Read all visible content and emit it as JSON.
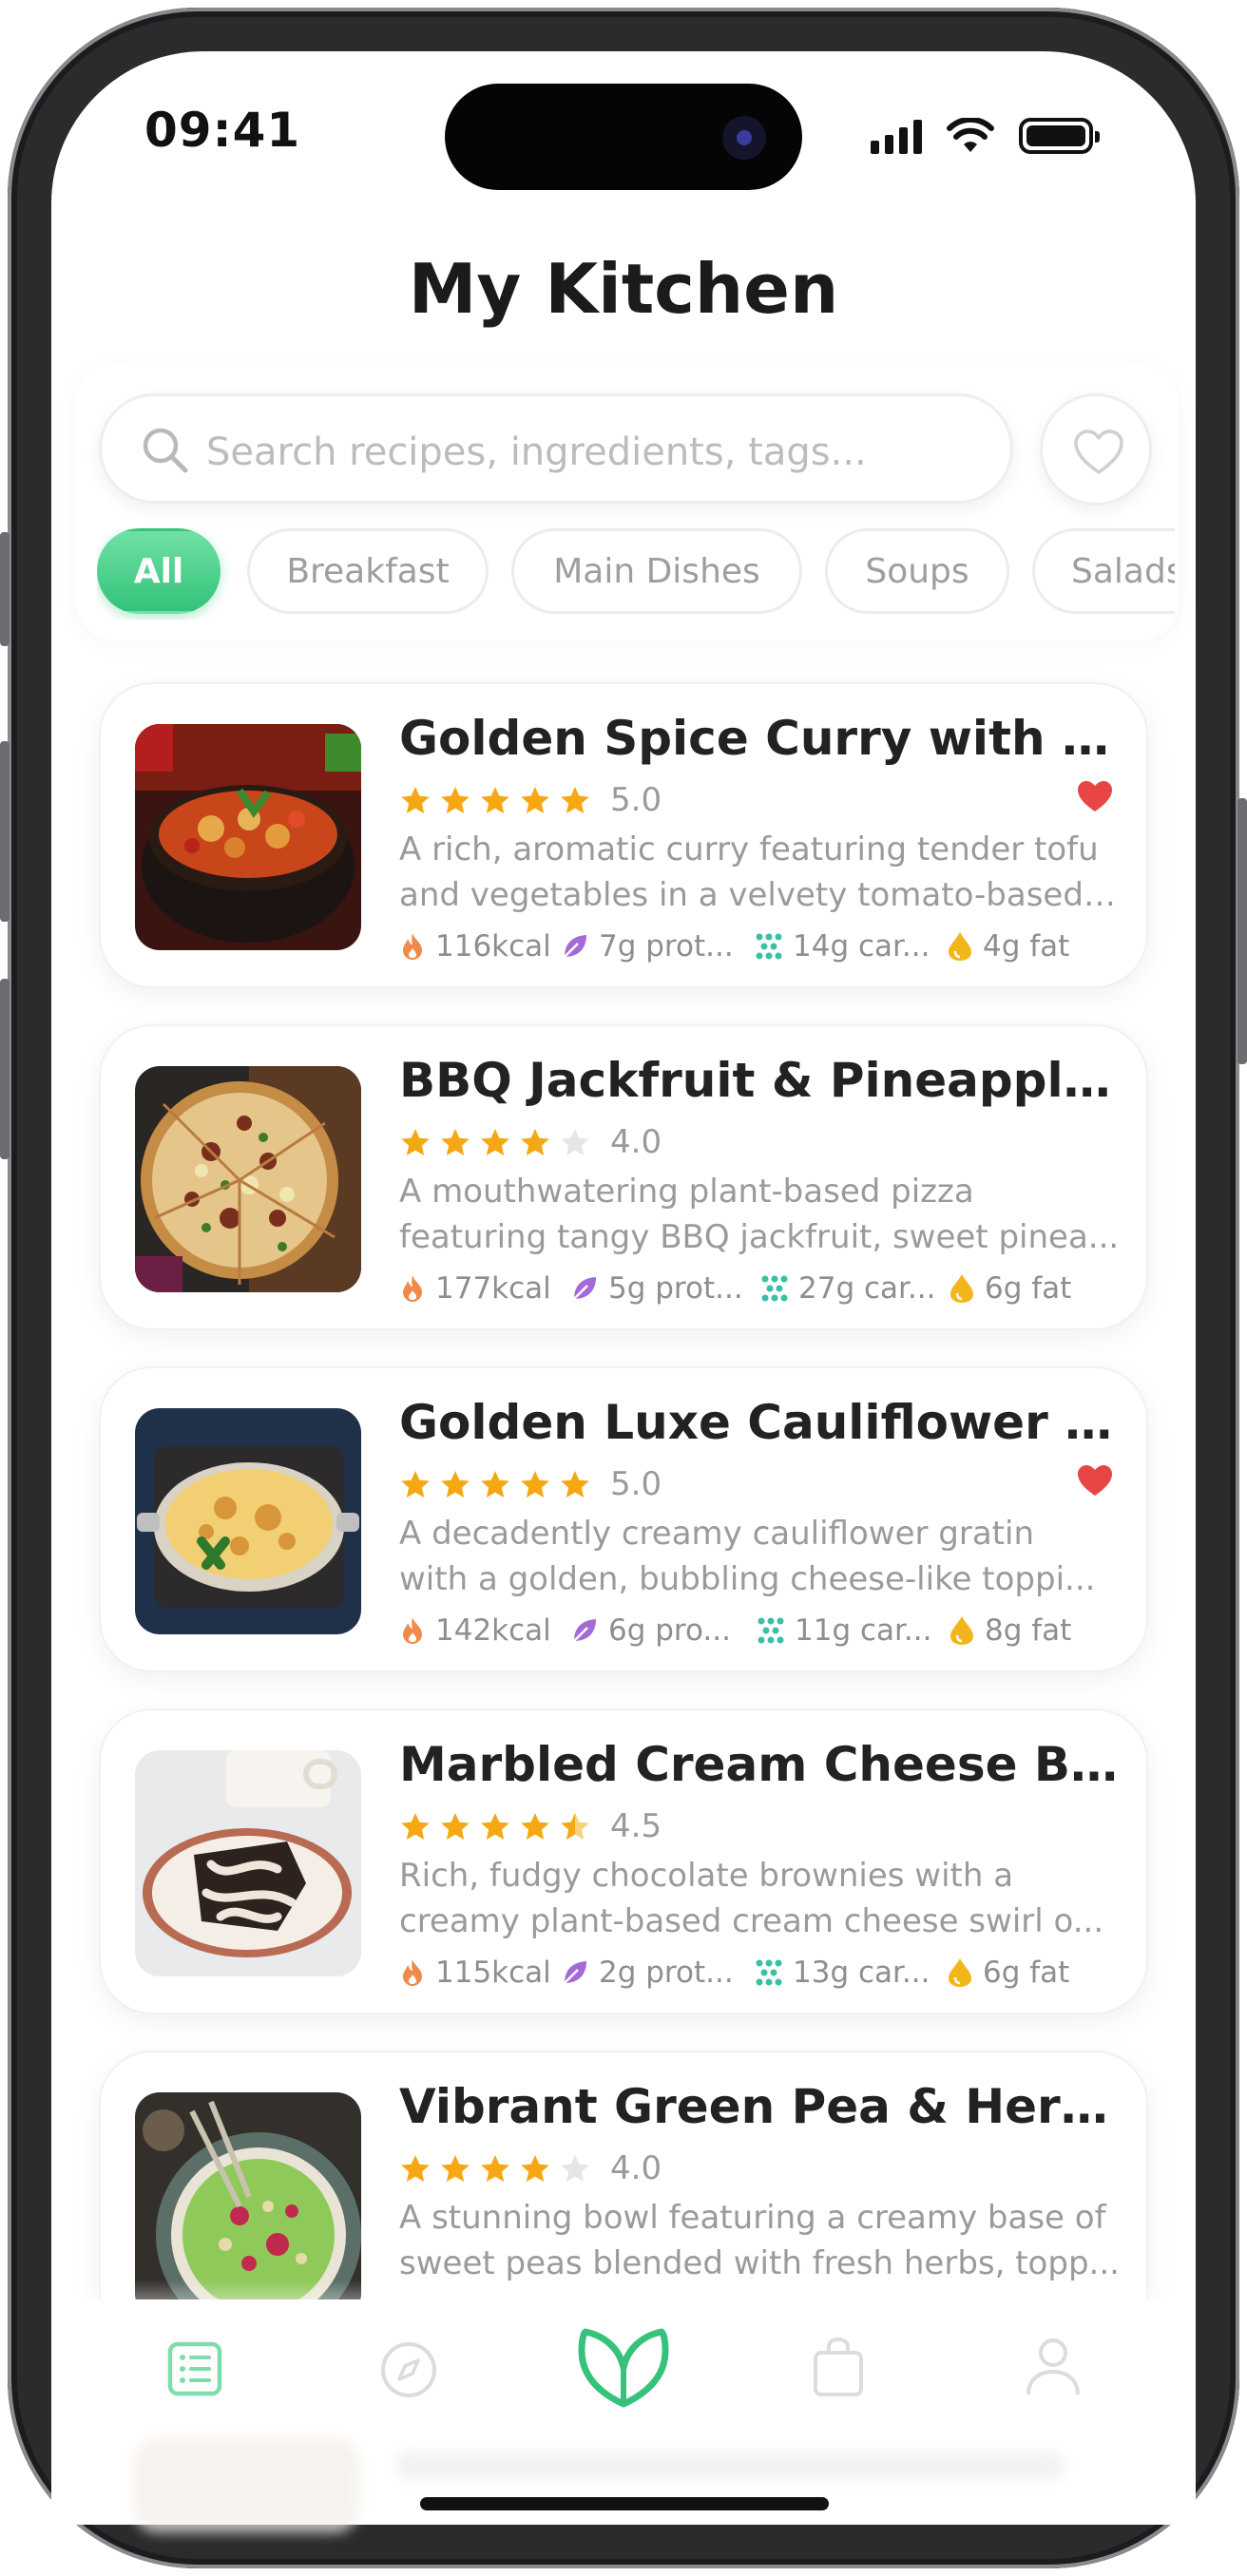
{
  "status_bar": {
    "time": "09:41"
  },
  "page": {
    "title": "My Kitchen"
  },
  "search": {
    "placeholder": "Search recipes, ingredients, tags..."
  },
  "categories": [
    {
      "label": "All",
      "active": true
    },
    {
      "label": "Breakfast",
      "active": false
    },
    {
      "label": "Main Dishes",
      "active": false
    },
    {
      "label": "Soups",
      "active": false
    },
    {
      "label": "Salads",
      "active": false
    }
  ],
  "recipes": [
    {
      "title": "Golden Spice Curry with Hi...",
      "rating": 5.0,
      "rating_text": "5.0",
      "favorite": true,
      "desc_line1": "A rich, aromatic curry featuring tender tofu",
      "desc_line2": "and vegetables in a velvety tomato-based ...",
      "kcal": "116kcal",
      "protein": "7g prot...",
      "carbs": "14g car...",
      "fat": "4g fat"
    },
    {
      "title": "BBQ Jackfruit & Pineapple ...",
      "rating": 4.0,
      "rating_text": "4.0",
      "favorite": false,
      "desc_line1": "A mouthwatering plant-based pizza",
      "desc_line2": "featuring tangy BBQ jackfruit, sweet pinea...",
      "kcal": "177kcal",
      "protein": "5g prot...",
      "carbs": "27g car...",
      "fat": "6g fat"
    },
    {
      "title": "Golden Luxe Cauliflower & ...",
      "rating": 5.0,
      "rating_text": "5.0",
      "favorite": true,
      "desc_line1": "A decadently creamy cauliflower gratin",
      "desc_line2": "with a golden, bubbling cheese-like toppi...",
      "kcal": "142kcal",
      "protein": "6g pro...",
      "carbs": "11g car...",
      "fat": "8g fat"
    },
    {
      "title": "Marbled Cream Cheese Bro...",
      "rating": 4.5,
      "rating_text": "4.5",
      "favorite": false,
      "desc_line1": "Rich, fudgy chocolate brownies with a",
      "desc_line2": "creamy plant-based cream cheese swirl o...",
      "kcal": "115kcal",
      "protein": "2g prot...",
      "carbs": "13g car...",
      "fat": "6g fat"
    },
    {
      "title": "Vibrant Green Pea & Herb B...",
      "rating": 4.0,
      "rating_text": "4.0",
      "favorite": false,
      "desc_line1": "A stunning bowl featuring a creamy base of",
      "desc_line2": "sweet peas blended with fresh herbs, topp..."
    }
  ],
  "tab_bar": {
    "items": [
      {
        "icon": "recipe-list-icon",
        "active": true
      },
      {
        "icon": "compass-icon",
        "active": false
      },
      {
        "icon": "leaf-heart-icon",
        "active": false
      },
      {
        "icon": "shopping-bag-icon",
        "active": false
      },
      {
        "icon": "profile-icon",
        "active": false
      }
    ]
  },
  "colors": {
    "accent": "#34c37b",
    "star": "#f5a814",
    "star_empty": "#e6e6e6",
    "heart": "#e84545",
    "kcal": "#f08a4b",
    "protein": "#a46ad8",
    "carbs": "#3bbfa6",
    "fat": "#f2b51c"
  }
}
